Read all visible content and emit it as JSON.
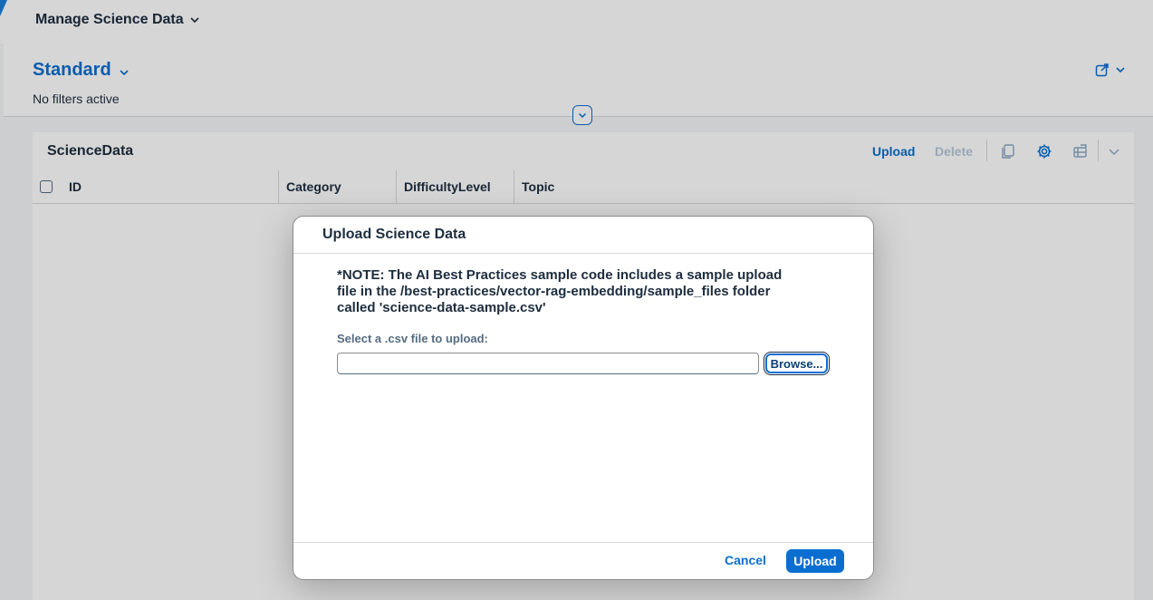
{
  "app": {
    "title": "Manage Science Data"
  },
  "header": {
    "variant": "Standard",
    "filter_status": "No filters active"
  },
  "table": {
    "title": "ScienceData",
    "toolbar": {
      "upload_label": "Upload",
      "delete_label": "Delete"
    },
    "columns": [
      "ID",
      "Category",
      "DifficultyLevel",
      "Topic"
    ]
  },
  "dialog": {
    "title": "Upload Science Data",
    "note_lines": [
      "*NOTE: The AI Best Practices sample code includes a sample upload",
      "file in the /best-practices/vector-rag-embedding/sample_files folder",
      "called 'science-data-sample.csv'"
    ],
    "file_label": "Select a .csv file to upload:",
    "file_value": "",
    "browse_label": "Browse...",
    "cancel_label": "Cancel",
    "upload_label": "Upload"
  },
  "colors": {
    "accent": "#0a6ed1",
    "disabled": "#b5c8dc",
    "text": "#1d2d3e"
  },
  "icons": {
    "title_menu": "chevron-down-icon",
    "variant_menu": "chevron-down-icon",
    "share": "share-icon",
    "collapse": "chevron-down-icon",
    "copy": "copy-icon",
    "settings": "gear-icon",
    "export": "export-icon",
    "export_menu": "chevron-down-icon"
  }
}
